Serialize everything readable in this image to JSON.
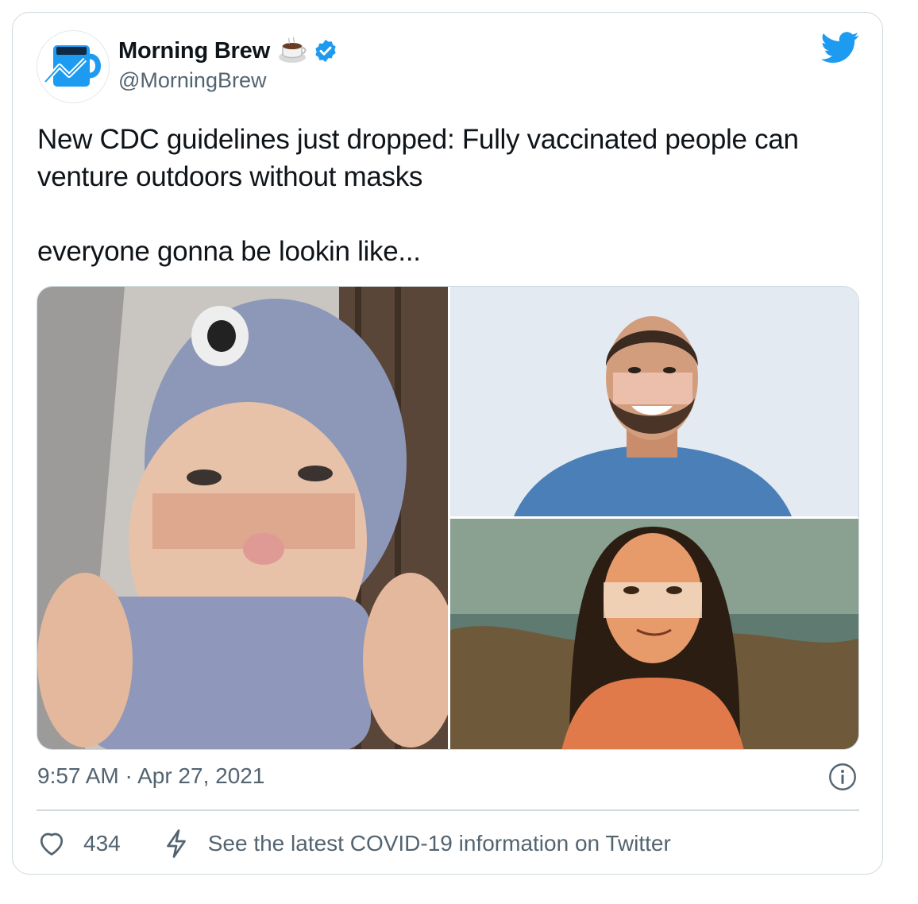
{
  "account": {
    "name": "Morning Brew",
    "handle": "@MorningBrew",
    "verified": true,
    "avatar_icon": "blue-mug-chart-icon",
    "name_emoji": "coffee-cup-icon"
  },
  "tweet": {
    "text": "New CDC guidelines just dropped: Fully vaccinated people can venture outdoors without masks\n\neveryone gonna be lookin like...",
    "timestamp": "9:57 AM · Apr 27, 2021",
    "likes": "434",
    "covid_link": "See the latest COVID-19 information on Twitter"
  },
  "media": [
    {
      "description_icon": "baby-mask-tan-photo"
    },
    {
      "description_icon": "man-mask-tan-photo"
    },
    {
      "description_icon": "mona-lisa-mask-tan-photo"
    }
  ],
  "colors": {
    "twitter_blue": "#1d9bf0",
    "text_primary": "#0f1419",
    "text_secondary": "#536471",
    "border": "#cfd9de"
  }
}
